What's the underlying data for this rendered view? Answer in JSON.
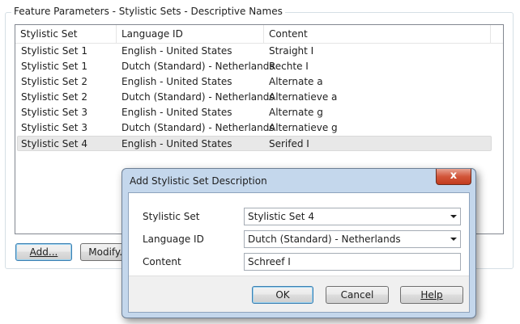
{
  "group_title": "Feature Parameters - Stylistic Sets - Descriptive Names",
  "columns": [
    "Stylistic Set",
    "Language ID",
    "Content"
  ],
  "rows": [
    {
      "set": "Stylistic Set 1",
      "lang": "English - United States",
      "content": "Straight I"
    },
    {
      "set": "Stylistic Set 1",
      "lang": "Dutch (Standard) - Netherlands",
      "content": "Rechte I"
    },
    {
      "set": "Stylistic Set 2",
      "lang": "English - United States",
      "content": "Alternate a"
    },
    {
      "set": "Stylistic Set 2",
      "lang": "Dutch (Standard) - Netherlands",
      "content": "Alternatieve a"
    },
    {
      "set": "Stylistic Set 3",
      "lang": "English - United States",
      "content": "Alternate g"
    },
    {
      "set": "Stylistic Set 3",
      "lang": "Dutch (Standard) - Netherlands",
      "content": "Alternatieve g"
    },
    {
      "set": "Stylistic Set 4",
      "lang": "English - United States",
      "content": "Serifed I"
    }
  ],
  "buttons": {
    "add": "Add...",
    "modify": "Modify..."
  },
  "dialog": {
    "title": "Add Stylistic Set Description",
    "close_glyph": "x",
    "labels": {
      "set": "Stylistic Set",
      "lang": "Language ID",
      "content": "Content"
    },
    "values": {
      "set": "Stylistic Set 4",
      "lang": "Dutch (Standard) - Netherlands",
      "content": "Schreef I"
    },
    "ok": "OK",
    "cancel": "Cancel",
    "help": "Help"
  }
}
